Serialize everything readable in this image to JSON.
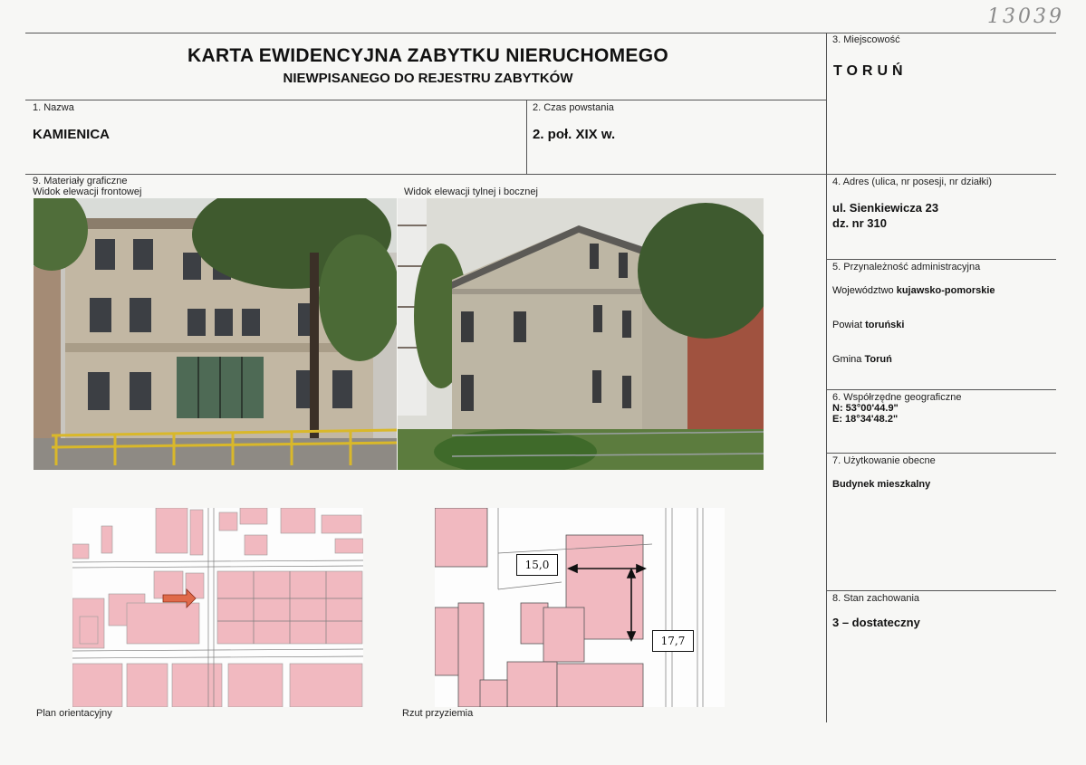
{
  "handwritten_number": "13039",
  "header": {
    "title_line1": "KARTA EWIDENCYJNA ZABYTKU NIERUCHOMEGO",
    "title_line2": "NIEWPISANEGO DO REJESTRU ZABYTKÓW"
  },
  "field_3": {
    "label": "3. Miejscowość",
    "value": "TORUŃ"
  },
  "field_1": {
    "label": "1. Nazwa",
    "value": "KAMIENICA"
  },
  "field_2": {
    "label": "2. Czas powstania",
    "value": "2. poł. XIX w."
  },
  "field_9": {
    "label": "9. Materiały graficzne",
    "caption_front": "Widok elewacji frontowej",
    "caption_back": "Widok elewacji tylnej i bocznej",
    "caption_plan": "Plan orientacyjny",
    "caption_floor": "Rzut przyziemia",
    "measure_width": "15,0",
    "measure_depth": "17,7"
  },
  "field_4": {
    "label": "4. Adres (ulica, nr posesji, nr działki)",
    "line1": "ul. Sienkiewicza 23",
    "line2": "dz. nr 310"
  },
  "field_5": {
    "label": "5. Przynależność administracyjna",
    "voivodeship_prefix": "Województwo ",
    "voivodeship": "kujawsko-pomorskie",
    "county_prefix": "Powiat ",
    "county": "toruński",
    "commune_prefix": "Gmina ",
    "commune": "Toruń"
  },
  "field_6": {
    "label": "6. Współrzędne geograficzne",
    "lat": "N: 53°00'44.9\"",
    "lon": "E: 18°34'48.2\""
  },
  "field_7": {
    "label": "7. Użytkowanie obecne",
    "value": "Budynek mieszkalny"
  },
  "field_8": {
    "label": "8. Stan zachowania",
    "value": "3 – dostateczny"
  },
  "colors": {
    "parcel_fill": "#f1b9c0",
    "map_line": "#9a9a9a",
    "arrow": "#e06a4a"
  }
}
